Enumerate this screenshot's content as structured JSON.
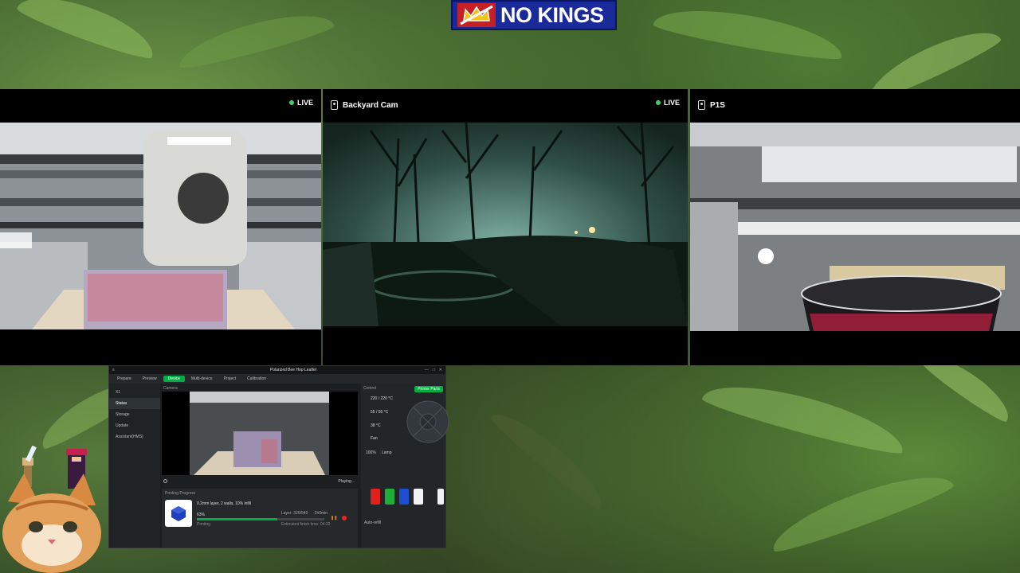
{
  "banner": {
    "text": "NO KINGS"
  },
  "cameras": [
    {
      "title": "",
      "live": "LIVE",
      "icon": "camera-icon"
    },
    {
      "title": "Backyard Cam",
      "live": "LIVE",
      "icon": "camera-icon"
    },
    {
      "title": "P1S",
      "live": "",
      "icon": "camera-icon"
    }
  ],
  "app": {
    "window_title": "Polarized Bee Hop Leaflet",
    "tabs": [
      {
        "label": "Prepare"
      },
      {
        "label": "Preview"
      },
      {
        "label": "Device",
        "active": true
      },
      {
        "label": "Multi-device"
      },
      {
        "label": "Project"
      },
      {
        "label": "Calibration"
      }
    ],
    "printer": "X1",
    "sidebar": [
      "Status",
      "Storage",
      "Update",
      "Assistant(HMS)"
    ],
    "camera_label": "Camera",
    "playing": "Playing...",
    "printing_progress_label": "Printing Progress",
    "print_name": "0.2mm layer, 2 walls, 10% infill",
    "percent": "63%",
    "layer": "Layer: 326/540",
    "remaining": "-2h0min",
    "status": "Printing",
    "estimated": "Estimated finish time: 04:22",
    "control_label": "Control",
    "printer_parts": "Printer Parts",
    "temps": [
      "220 / 220 °C",
      "55 / 55 °C",
      "38 °C"
    ],
    "fan_label": "Fan",
    "speed": "100%",
    "lamp": "Lamp",
    "auto_refill": "Auto-refill",
    "filaments": [
      {
        "label": "PLA",
        "color": "#e0201c"
      },
      {
        "label": "PLA",
        "color": "#1fae3c"
      },
      {
        "label": "PLA",
        "color": "#1a4fd0"
      },
      {
        "label": "PLA",
        "color": "#f2f2f2"
      }
    ]
  }
}
